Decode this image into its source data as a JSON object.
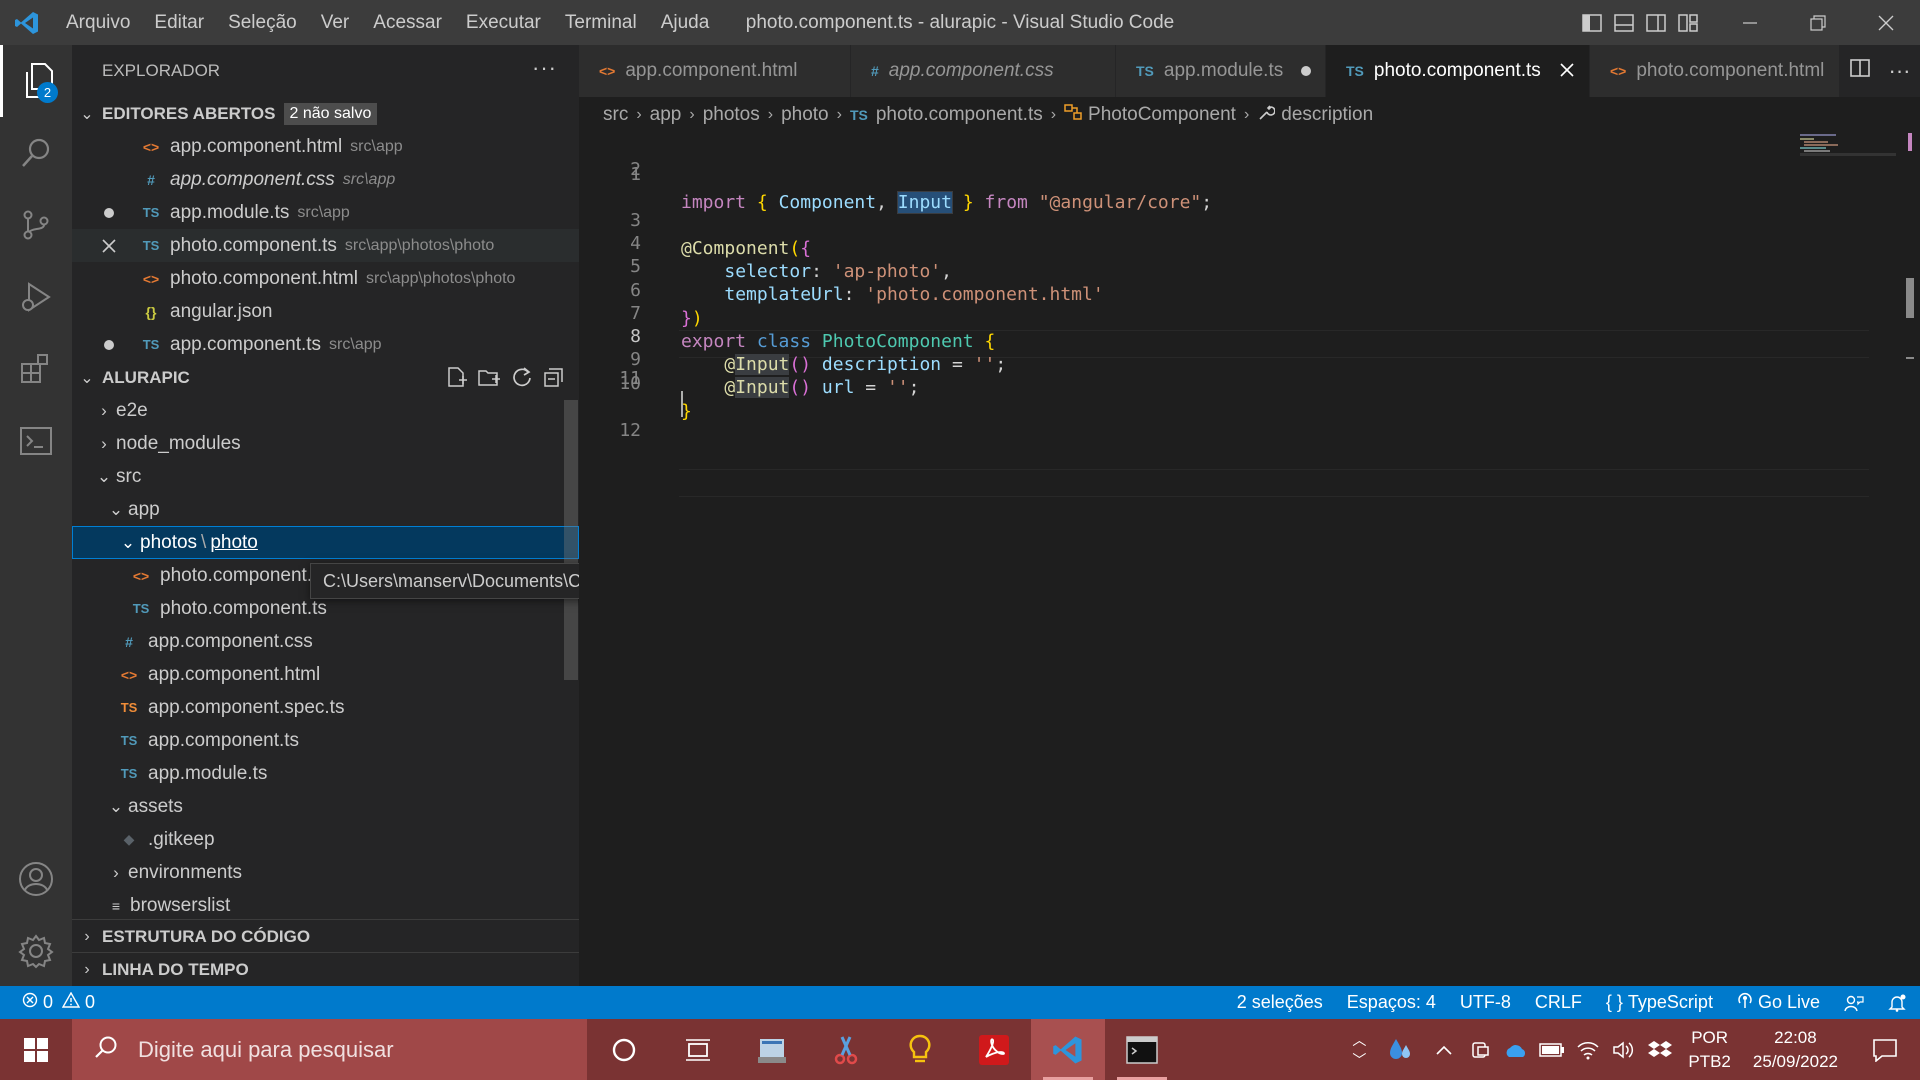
{
  "window": {
    "title": "photo.component.ts - alurapic - Visual Studio Code",
    "menu": [
      "Arquivo",
      "Editar",
      "Seleção",
      "Ver",
      "Acessar",
      "Executar",
      "Terminal",
      "Ajuda"
    ]
  },
  "activity": {
    "explorer_badge": "2"
  },
  "sidebar": {
    "title": "EXPLORADOR",
    "more": "···",
    "open_editors": {
      "header": "EDITORES ABERTOS",
      "unsaved_tag": "2 não salvo",
      "items": [
        {
          "name": "app.component.html",
          "path": "src\\app"
        },
        {
          "name": "app.component.css",
          "path": "src\\app"
        },
        {
          "name": "app.module.ts",
          "path": "src\\app"
        },
        {
          "name": "photo.component.ts",
          "path": "src\\app\\photos\\photo"
        },
        {
          "name": "photo.component.html",
          "path": "src\\app\\photos\\photo"
        },
        {
          "name": "angular.json",
          "path": ""
        },
        {
          "name": "app.component.ts",
          "path": "src\\app"
        }
      ]
    },
    "project": {
      "header": "ALURAPIC",
      "tree": [
        {
          "label": "e2e"
        },
        {
          "label": "node_modules"
        },
        {
          "label": "src"
        },
        {
          "label": "app"
        },
        {
          "label": "photos",
          "label2": "photo",
          "sep": "\\"
        },
        {
          "label": "photo.component.html"
        },
        {
          "label": "photo.component.ts"
        },
        {
          "label": "app.component.css"
        },
        {
          "label": "app.component.html"
        },
        {
          "label": "app.component.spec.ts"
        },
        {
          "label": "app.component.ts"
        },
        {
          "label": "app.module.ts"
        },
        {
          "label": "assets"
        },
        {
          "label": ".gitkeep"
        },
        {
          "label": "environments"
        },
        {
          "label": "browserslist"
        }
      ]
    },
    "outline": "ESTRUTURA DO CÓDIGO",
    "timeline": "LINHA DO TEMPO",
    "tooltip": "C:\\Users\\manserv\\Documents\\Curso de Angular\\alurapic\\src\\app\\photos\\photo"
  },
  "tabs": [
    {
      "label": "app.component.html",
      "icon": "<>"
    },
    {
      "label": "app.component.css",
      "icon": "#"
    },
    {
      "label": "app.module.ts",
      "icon": "TS"
    },
    {
      "label": "photo.component.ts",
      "icon": "TS"
    },
    {
      "label": "photo.component.html",
      "icon": "<>"
    }
  ],
  "breadcrumb": [
    "src",
    "app",
    "photos",
    "photo",
    "photo.component.ts",
    "PhotoComponent",
    "description"
  ],
  "editor": {
    "line_numbers": [
      "1",
      "2",
      "3",
      "4",
      "5",
      "6",
      "7",
      "8",
      "9",
      "10",
      "11",
      "12"
    ],
    "code": {
      "l1": {
        "import": "import",
        "b1": "{",
        "comp": "Component",
        "comma": ",",
        "input": "Input",
        "b2": "}",
        "from": "from",
        "mod": "\"@angular/core\"",
        "semi": ";"
      },
      "l3": {
        "at": "@",
        "dec": "Component",
        "open": "(",
        "brace": "{"
      },
      "l4": {
        "key": "selector",
        "colon": ":",
        "val": "'ap-photo'",
        "comma": ","
      },
      "l5": {
        "key": "templateUrl",
        "colon": ":",
        "val": "'photo.component.html'"
      },
      "l6": {
        "brace": "}",
        "close": ")"
      },
      "l7": {
        "export": "export",
        "class": "class",
        "name": "PhotoComponent",
        "brace": "{"
      },
      "l8": {
        "at": "@",
        "dec": "Input",
        "parens": "()",
        "prop": "description",
        "eq": "=",
        "val": "''",
        "semi": ";"
      },
      "l9": {
        "at": "@",
        "dec": "Input",
        "parens": "()",
        "prop": "url",
        "eq": "=",
        "val": "''",
        "semi": ";"
      },
      "l10": {
        "brace": "}"
      }
    }
  },
  "statusbar": {
    "errors": "0",
    "warnings": "0",
    "selections": "2 seleções",
    "spaces": "Espaços: 4",
    "encoding": "UTF-8",
    "eol": "CRLF",
    "language": "TypeScript",
    "golive": "Go Live"
  },
  "taskbar": {
    "search_placeholder": "Digite aqui para pesquisar",
    "lang_top": "POR",
    "lang_bottom": "PTB2",
    "time": "22:08",
    "date": "25/09/2022"
  },
  "colors": {
    "accent": "#007acc",
    "taskbar": "#7a3333",
    "selection": "#04395e"
  }
}
